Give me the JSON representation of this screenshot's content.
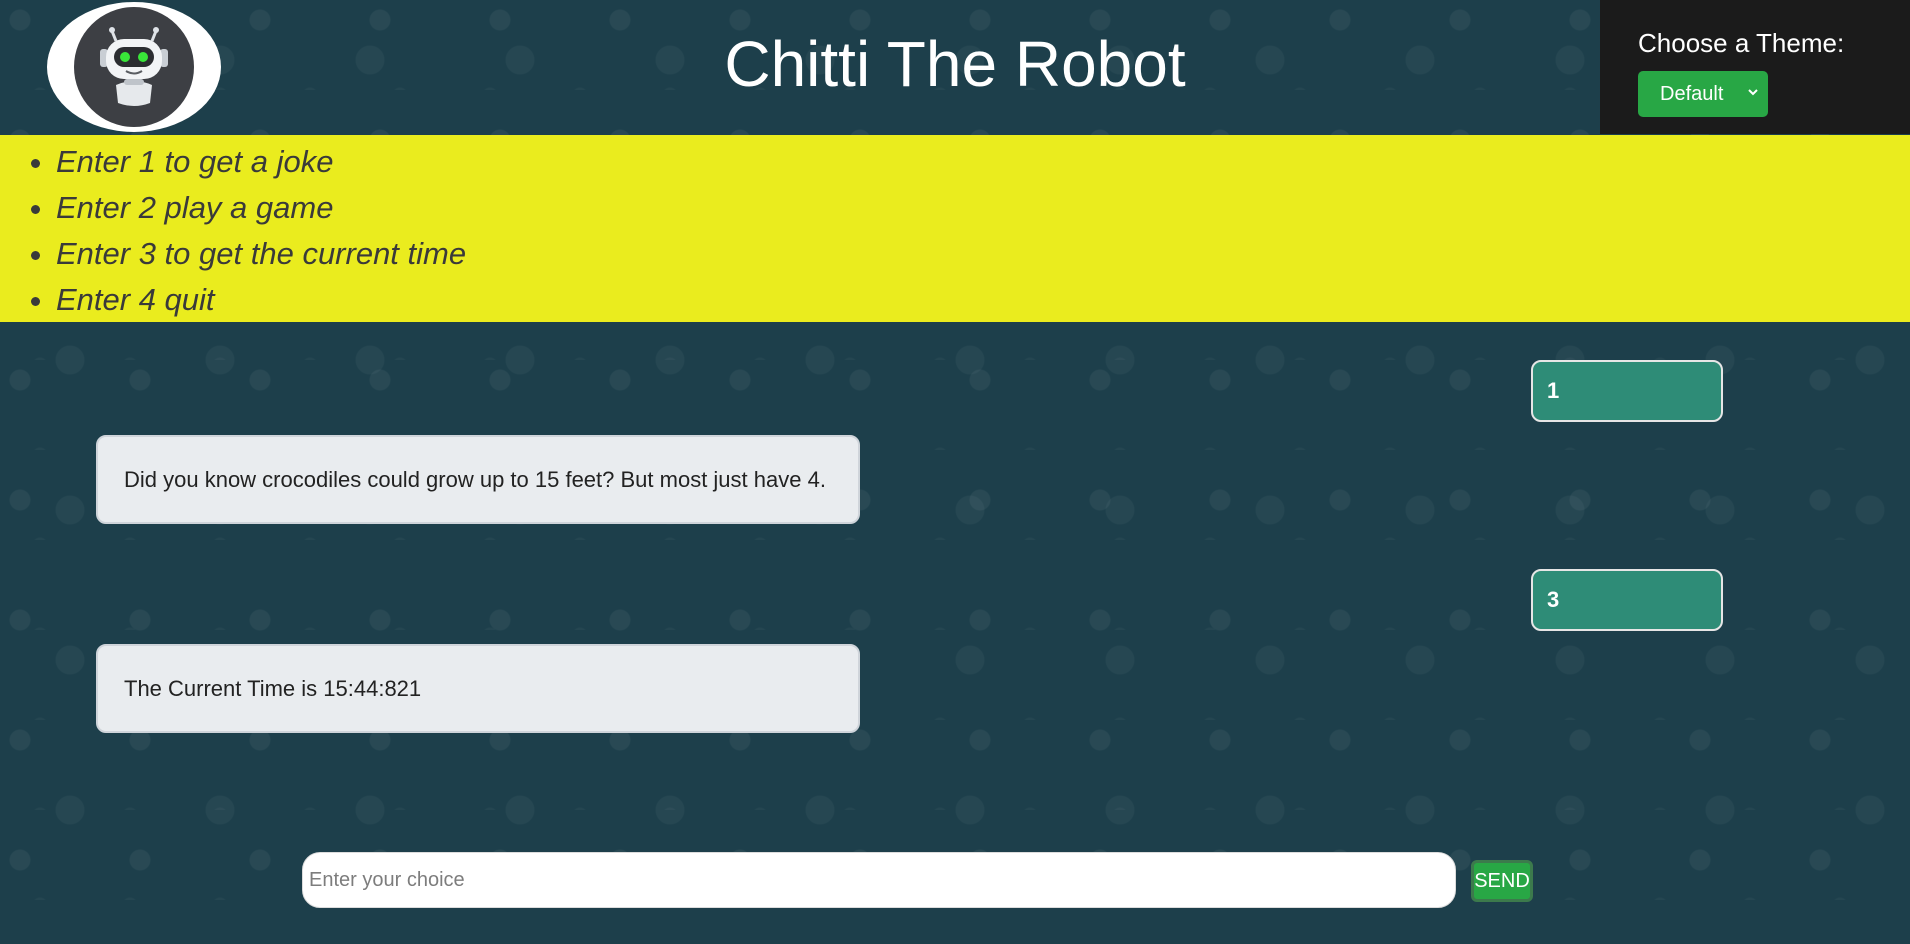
{
  "app": {
    "title": "Chitti The Robot"
  },
  "theme": {
    "label": "Choose a Theme:",
    "selected": "Default",
    "button_color": "#28a745"
  },
  "menu": {
    "items": [
      "Enter 1 to get a joke",
      "Enter 2 play a game",
      "Enter 3 to get the current time",
      "Enter 4 quit"
    ],
    "background": "#eaec1e"
  },
  "chat": {
    "messages": [
      {
        "sender": "user",
        "text": "1"
      },
      {
        "sender": "bot",
        "text": "Did you know crocodiles could grow up to 15 feet? But most just have 4."
      },
      {
        "sender": "user",
        "text": "3"
      },
      {
        "sender": "bot",
        "text": "The Current Time is 15:44:821"
      }
    ]
  },
  "input": {
    "placeholder": "Enter your choice",
    "value": "",
    "send_label": "SEND"
  },
  "icons": {
    "logo": "robot-icon",
    "theme_dropdown": "chevron-down-icon"
  }
}
